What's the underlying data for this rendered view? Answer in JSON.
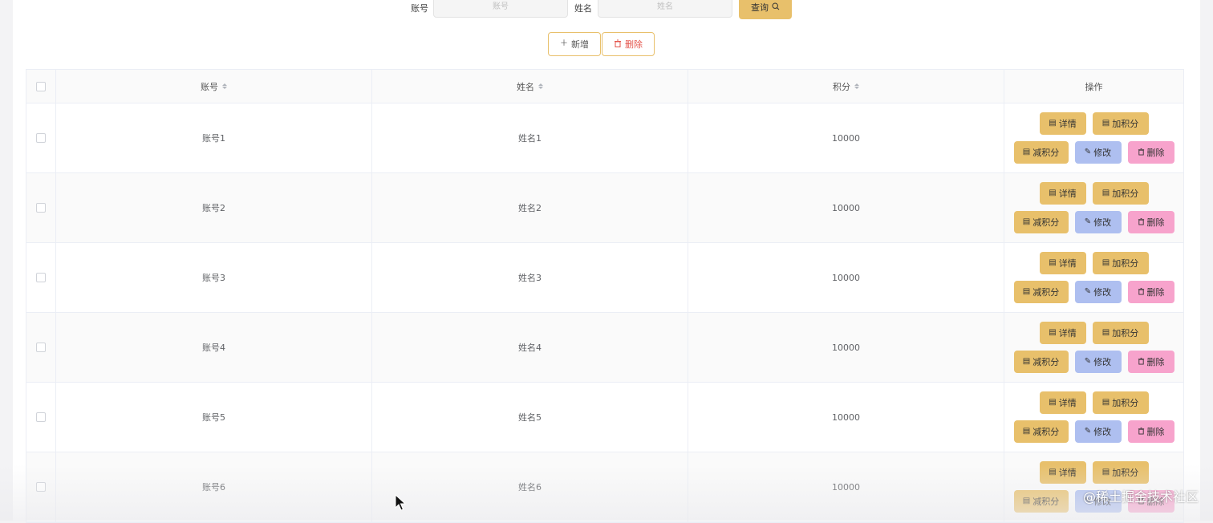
{
  "search": {
    "account_label": "账号",
    "account_placeholder": "账号",
    "name_label": "姓名",
    "name_placeholder": "姓名",
    "query_label": "查询"
  },
  "toolbar": {
    "add_label": "新增",
    "delete_label": "删除"
  },
  "table": {
    "columns": [
      "账号",
      "姓名",
      "积分",
      "操作"
    ],
    "rows": [
      {
        "account": "账号1",
        "name": "姓名1",
        "score": "10000"
      },
      {
        "account": "账号2",
        "name": "姓名2",
        "score": "10000"
      },
      {
        "account": "账号3",
        "name": "姓名3",
        "score": "10000"
      },
      {
        "account": "账号4",
        "name": "姓名4",
        "score": "10000"
      },
      {
        "account": "账号5",
        "name": "姓名5",
        "score": "10000"
      },
      {
        "account": "账号6",
        "name": "姓名6",
        "score": "10000"
      }
    ],
    "actions": {
      "detail": "详情",
      "add_points": "加积分",
      "reduce_points": "减积分",
      "edit": "修改",
      "delete": "删除"
    }
  },
  "icons": {
    "doc": "document-icon",
    "edit": "pencil-icon",
    "delete": "trash-icon",
    "search": "search-icon",
    "add": "plus-icon"
  },
  "colors": {
    "accent": "#e8c06b",
    "edit": "#aebff0",
    "delete": "#f7a3cc",
    "danger_text": "#e4544b"
  },
  "watermark": "@稀土掘金技术社区"
}
